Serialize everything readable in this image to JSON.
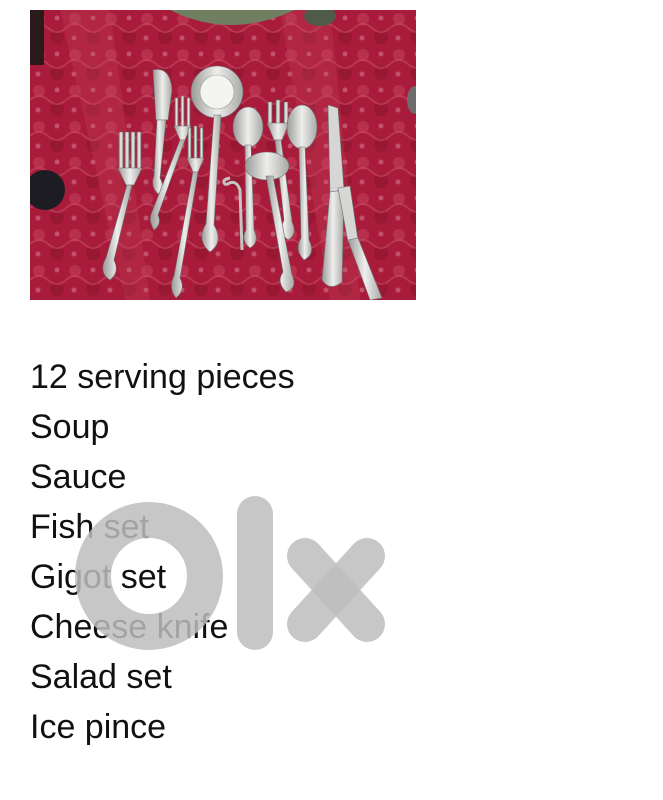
{
  "listing": {
    "photo": {
      "icon": "cutlery-set-photo",
      "colors": {
        "tablecloth": "#b01d3d",
        "silver": "#cfcfcf",
        "cloth_top": "#6f7f60"
      }
    },
    "description_lines": [
      "12 serving pieces",
      "Soup",
      "Sauce",
      "Fish set",
      "Gigot set",
      "Cheese knife",
      "Salad set",
      "Ice pince"
    ],
    "watermark": {
      "icon": "olx-logo",
      "text": "olx",
      "color": "#bdbdbd"
    }
  }
}
